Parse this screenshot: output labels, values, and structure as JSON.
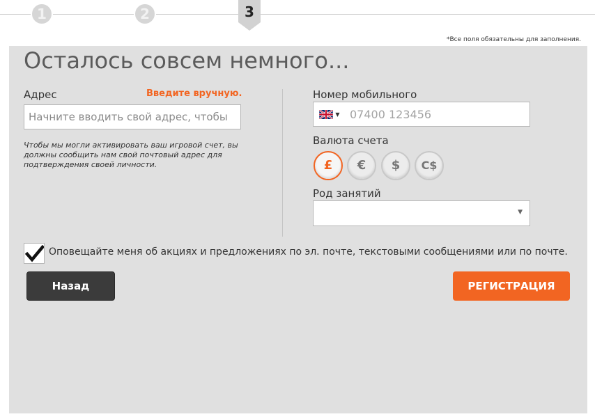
{
  "steps": [
    {
      "number": "1",
      "state": "done"
    },
    {
      "number": "2",
      "state": "done"
    },
    {
      "number": "3",
      "state": "current"
    }
  ],
  "required_note": "*Все поля обязательны для заполнения.",
  "title": "Осталось совсем немного...",
  "address": {
    "label": "Адрес",
    "manual_link": "Введите вручную.",
    "placeholder": "Начните вводить свой адрес, чтобы",
    "hint": "Чтобы мы могли активировать ваш игровой счет, вы должны сообщить нам свой почтовый адрес для подтверждения своей личности."
  },
  "phone": {
    "label": "Номер мобильного",
    "flag_icon": "uk-flag-icon",
    "placeholder": "07400 123456"
  },
  "currency": {
    "label": "Валюта счета",
    "options": [
      {
        "symbol": "£",
        "selected": true
      },
      {
        "symbol": "€",
        "selected": false
      },
      {
        "symbol": "$",
        "selected": false
      },
      {
        "symbol": "C$",
        "selected": false
      }
    ]
  },
  "occupation": {
    "label": "Род занятий",
    "value": ""
  },
  "consent": {
    "checked": true,
    "text": "Оповещайте меня об акциях и предложениях по эл. почте, текстовыми сообщениями или по почте."
  },
  "buttons": {
    "back": "Назад",
    "register": "РЕГИСТРАЦИЯ"
  },
  "colors": {
    "accent": "#f26522",
    "panel_bg": "#e0e0e0",
    "back_button": "#3b3b3b"
  }
}
